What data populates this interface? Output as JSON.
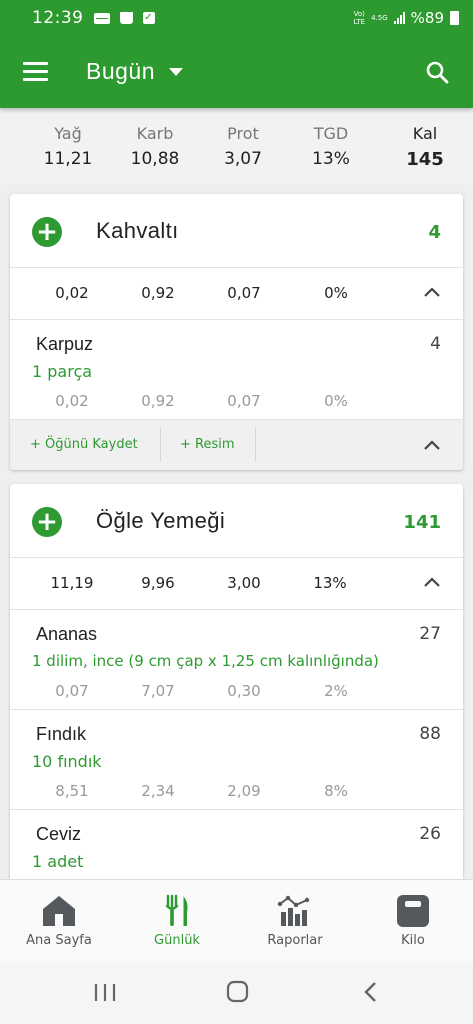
{
  "status_bar": {
    "time": "12:39",
    "network_top": "Vo)",
    "network_bottom": "LTE",
    "network_gen": "4.5G",
    "battery": "%89"
  },
  "app_bar": {
    "title": "Bugün"
  },
  "summary": {
    "labels": [
      "Yağ",
      "Karb",
      "Prot",
      "TGD",
      "Kal"
    ],
    "values": [
      "11,21",
      "10,88",
      "3,07",
      "13%",
      "145"
    ]
  },
  "meals": [
    {
      "name": "Kahvaltı",
      "kcal": "4",
      "macros": [
        "0,02",
        "0,92",
        "0,07",
        "0%"
      ],
      "foods": [
        {
          "name": "Karpuz",
          "portion": "1 parça",
          "kcal": "4",
          "macros": [
            "0,02",
            "0,92",
            "0,07",
            "0%"
          ]
        }
      ],
      "footer": {
        "save": "+ Öğünü Kaydet",
        "photo": "+ Resim"
      }
    },
    {
      "name": "Öğle Yemeği",
      "kcal": "141",
      "macros": [
        "11,19",
        "9,96",
        "3,00",
        "13%"
      ],
      "foods": [
        {
          "name": "Ananas",
          "portion": "1 dilim, ince (9 cm çap x 1,25 cm kalınlığında)",
          "kcal": "27",
          "macros": [
            "0,07",
            "7,07",
            "0,30",
            "2%"
          ]
        },
        {
          "name": "Fındık",
          "portion": "10 fındık",
          "kcal": "88",
          "macros": [
            "8,51",
            "2,34",
            "2,09",
            "8%"
          ]
        },
        {
          "name": "Ceviz",
          "portion": "1 adet",
          "kcal": "26",
          "macros": []
        }
      ]
    }
  ],
  "bottom_nav": [
    {
      "label": "Ana Sayfa",
      "icon": "home-icon"
    },
    {
      "label": "Günlük",
      "icon": "fork-knife-icon"
    },
    {
      "label": "Raporlar",
      "icon": "chart-icon"
    },
    {
      "label": "Kilo",
      "icon": "scale-icon"
    }
  ],
  "colors": {
    "primary": "#2c9a2e",
    "accent_text": "#2e9a31"
  }
}
